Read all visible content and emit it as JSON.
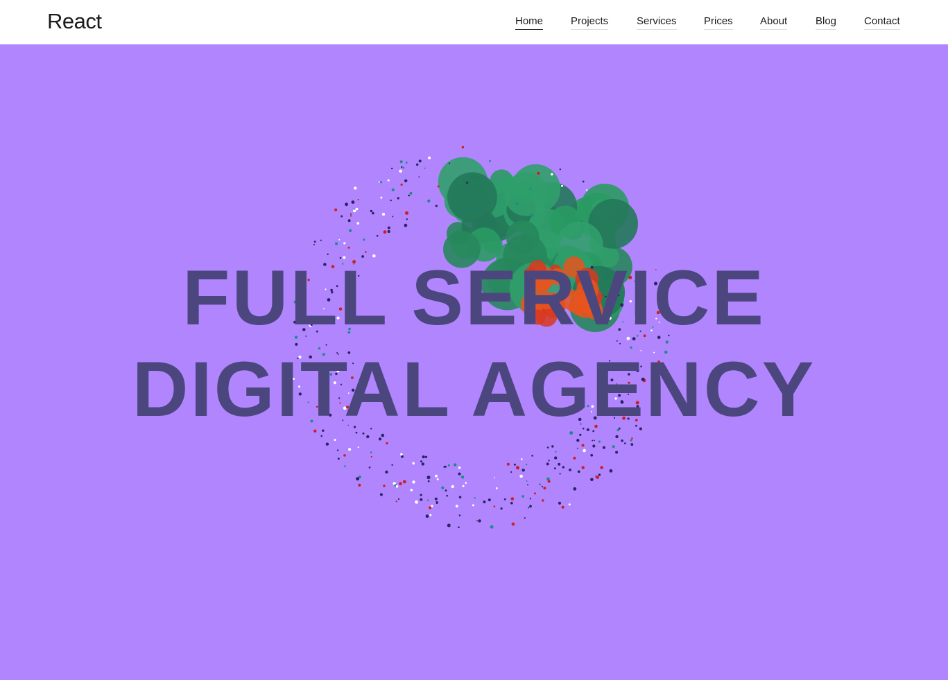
{
  "header": {
    "logo": "React",
    "nav": [
      {
        "label": "Home",
        "active": true
      },
      {
        "label": "Projects",
        "active": false
      },
      {
        "label": "Services",
        "active": false
      },
      {
        "label": "Prices",
        "active": false
      },
      {
        "label": "About",
        "active": false
      },
      {
        "label": "Blog",
        "active": false
      },
      {
        "label": "Contact",
        "active": false
      }
    ]
  },
  "hero": {
    "line1": "FULL SERVICE",
    "line2": "DIGITAL AGENCY"
  },
  "colors": {
    "background": "#b185fd",
    "headline": "#4b477e",
    "blob_green": "#2a9a63",
    "blob_orange": "#e8531f",
    "particles_dark": "#2a2466"
  }
}
